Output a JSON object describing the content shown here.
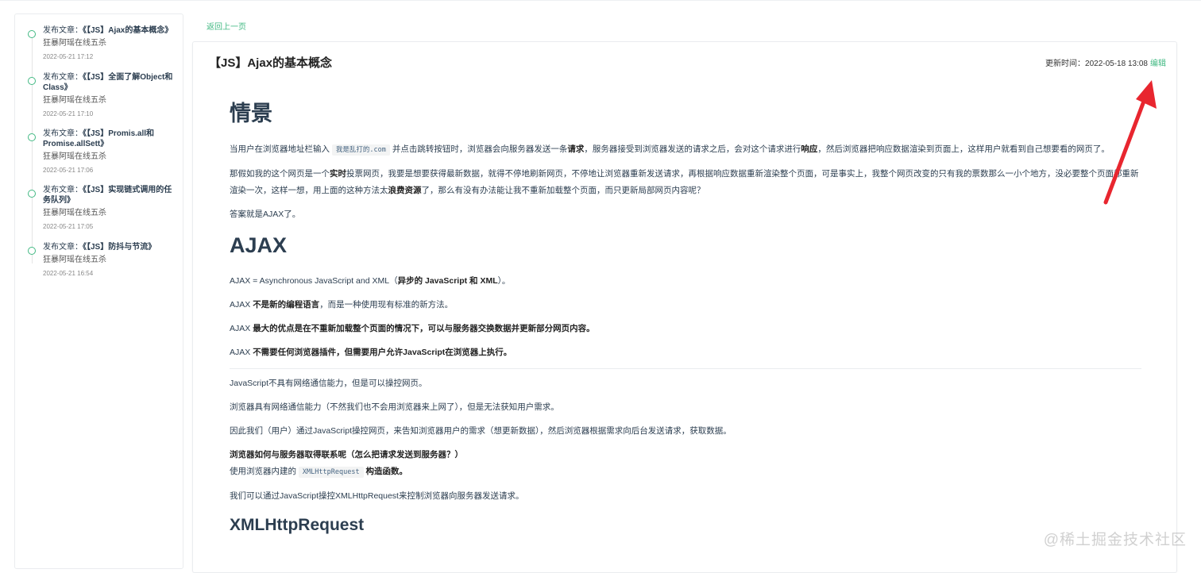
{
  "sidebar": {
    "items": [
      {
        "prefix": "发布文章：",
        "title": "《【JS】Ajax的基本概念》",
        "author": "狂暴阿瑶在线五杀",
        "time": "2022-05-21 17:12"
      },
      {
        "prefix": "发布文章：",
        "title": "《【JS】全面了解Object和Class》",
        "author": "狂暴阿瑶在线五杀",
        "time": "2022-05-21 17:10"
      },
      {
        "prefix": "发布文章：",
        "title": "《【JS】Promis.all和Promise.allSett》",
        "author": "狂暴阿瑶在线五杀",
        "time": "2022-05-21 17:06"
      },
      {
        "prefix": "发布文章：",
        "title": "《【JS】实现链式调用的任务队列》",
        "author": "狂暴阿瑶在线五杀",
        "time": "2022-05-21 17:05"
      },
      {
        "prefix": "发布文章：",
        "title": "《【JS】防抖与节流》",
        "author": "狂暴阿瑶在线五杀",
        "time": "2022-05-21 16:54"
      }
    ]
  },
  "back_link": "返回上一页",
  "article": {
    "title": "【JS】Ajax的基本概念",
    "update_label": "更新时间：",
    "update_time": "2022-05-18 13:08",
    "edit_label": "编辑",
    "h1_scene": "情景",
    "p1_a": "当用户在浏览器地址栏输入",
    "p1_code": "我是乱打的.com",
    "p1_b": "并点击跳转按钮时，浏览器会向服务器发送一条",
    "p1_bold1": "请求",
    "p1_c": "，服务器接受到浏览器发送的请求之后，会对这个请求进行",
    "p1_bold2": "响应",
    "p1_d": "，然后浏览器把响应数据渲染到页面上，这样用户就看到自己想要看的网页了。",
    "p2_a": "那假如我的这个网页是一个",
    "p2_bold1": "实时",
    "p2_b": "投票网页，我要是想要获得最新数据，就得不停地刷新网页，不停地让浏览器重新发送请求，再根据响应数据重新渲染整个页面，可是事实上，我整个网页改变的只有我的票数那么一小个地方，没必要整个页面都重新渲染一次，这样一想，用上面的这种方法太",
    "p2_bold2": "浪费资源",
    "p2_c": "了，那么有没有办法能让我不重新加载整个页面，而只更新局部网页内容呢？",
    "p3": "答案就是AJAX了。",
    "h1_ajax": "AJAX",
    "p4_a": "AJAX = Asynchronous JavaScript and XML（",
    "p4_bold": "异步的 JavaScript 和 XML",
    "p4_b": "）。",
    "p5_a": "AJAX ",
    "p5_bold": "不是新的编程语言",
    "p5_b": "，而是一种使用现有标准的新方法。",
    "p6_a": "AJAX ",
    "p6_bold": "最大的优点是在不重新加载整个页面的情况下，可以与服务器交换数据并更新部分网页内容。",
    "p7_a": "AJAX ",
    "p7_bold": "不需要任何浏览器插件，但需要用户允许JavaScript在浏览器上执行。",
    "p8": "JavaScript不具有网络通信能力，但是可以操控网页。",
    "p9": "浏览器具有网络通信能力（不然我们也不会用浏览器来上网了），但是无法获知用户需求。",
    "p10": "因此我们（用户）通过JavaScript操控网页，来告知浏览器用户的需求（想更新数据），然后浏览器根据需求向后台发送请求，获取数据。",
    "p11_bold": "浏览器如何与服务器取得联系呢（怎么把请求发送到服务器？）",
    "p11_a": "使用浏览器内建的",
    "p11_code": "XMLHttpRequest",
    "p11_bold2": "构造函数。",
    "p12": "我们可以通过JavaScript操控XMLHttpRequest来控制浏览器向服务器发送请求。",
    "h2": "XMLHttpRequest"
  },
  "watermark": "@稀土掘金技术社区",
  "colors": {
    "accent": "#42b983",
    "arrow": "#e8262f",
    "heading": "#2c3e50"
  }
}
